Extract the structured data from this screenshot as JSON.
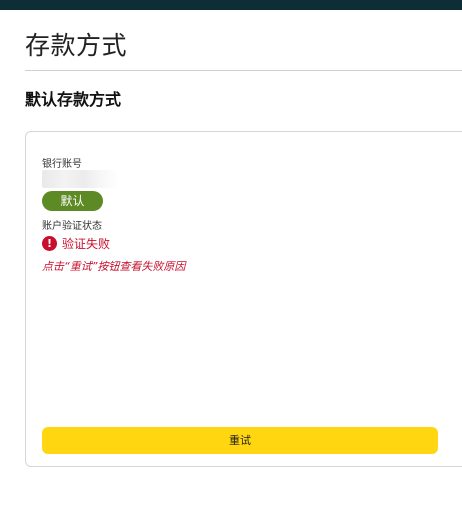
{
  "page": {
    "title": "存款方式",
    "section_title": "默认存款方式"
  },
  "card": {
    "account_label": "银行账号",
    "default_badge": "默认",
    "verification_label": "账户验证状态",
    "status_text": "验证失败",
    "hint_text": "点击“重试”按钮查看失败原因",
    "retry_label": "重试"
  },
  "colors": {
    "topbar": "#0e2e36",
    "badge": "#5d8a25",
    "error": "#c8102e",
    "button": "#ffd60f"
  },
  "icons": {
    "status": "error-icon"
  }
}
